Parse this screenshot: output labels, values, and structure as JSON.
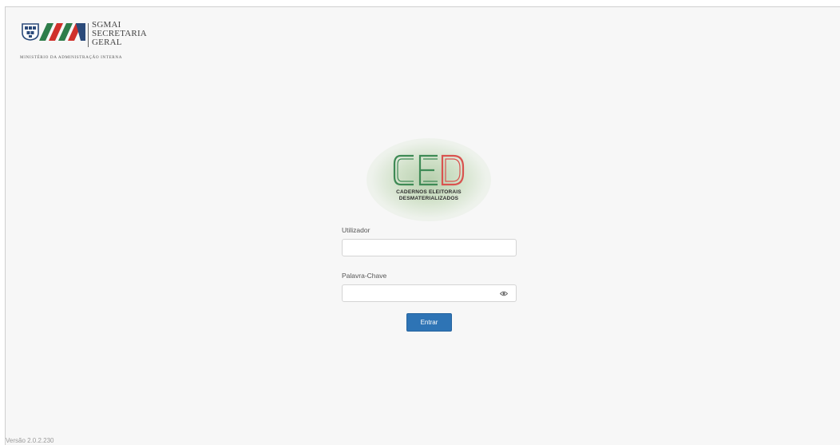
{
  "header": {
    "logo_lines": [
      "SGMAI",
      "SECRETARIA",
      "GERAL"
    ],
    "ministry": "MINISTÉRIO DA ADMINISTRAÇÃO INTERNA"
  },
  "emblem": {
    "letters": "CED",
    "caption_line1": "CADERNOS ELEITORAIS",
    "caption_line2": "DESMATERIALIZADOS",
    "colors": {
      "c": "#3e8a55",
      "e": "#3e8a55",
      "d": "#d9534f"
    }
  },
  "form": {
    "username_label": "Utilizador",
    "username_value": "",
    "password_label": "Palavra-Chave",
    "password_value": "",
    "submit_label": "Entrar"
  },
  "footer": {
    "version": "Versão 2.0.2.230"
  },
  "colors": {
    "accent": "#2e74b5",
    "background": "#f7f7f7"
  }
}
